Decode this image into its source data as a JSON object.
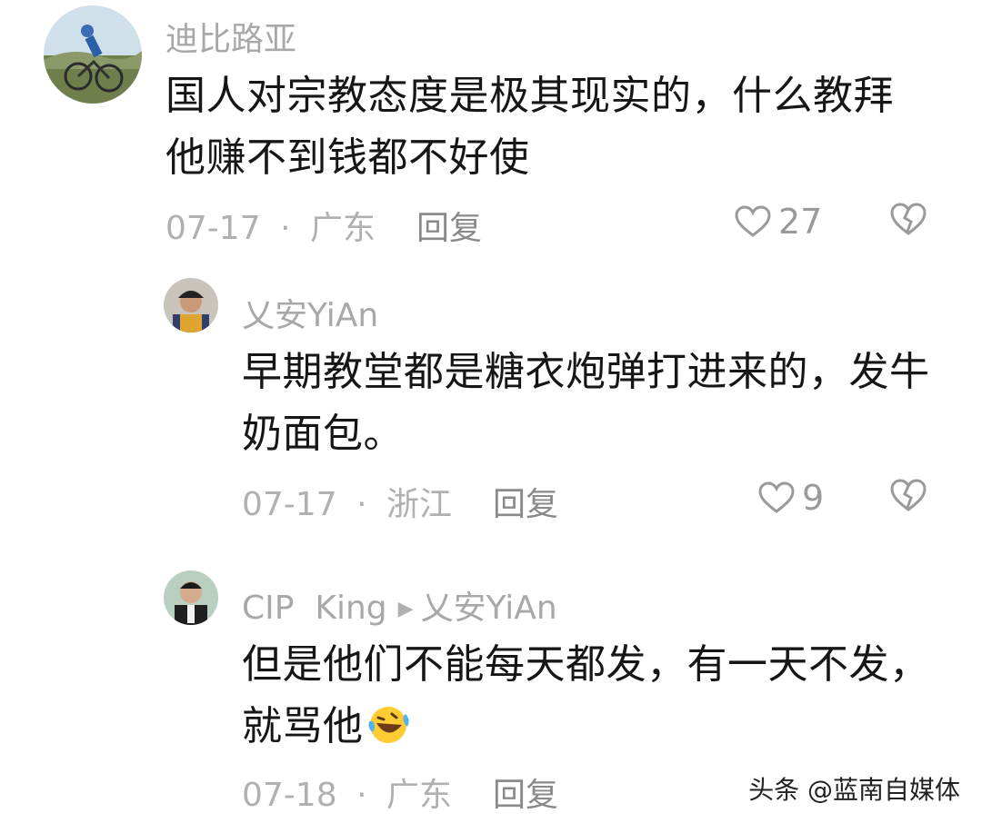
{
  "comments": [
    {
      "username": "迪比路亚",
      "text": "国人对宗教态度是极其现实的，什么教拜他赚不到钱都不好使",
      "line1": "国人对宗教态度是极其现实的，什么教拜",
      "line2": "他赚不到钱都不好使",
      "date": "07-17",
      "separator": "·",
      "location": "广东",
      "reply_label": "回复",
      "likes": "27"
    },
    {
      "username": "乂安YiAn",
      "line1": "早期教堂都是糖衣炮弹打进来的，发牛",
      "line2": "奶面包。",
      "date": "07-17",
      "separator": "·",
      "location": "浙江",
      "reply_label": "回复",
      "likes": "9"
    },
    {
      "username": "CIP  King",
      "reply_to": "乂安YiAn",
      "line1": "但是他们不能每天都发，有一天不发，",
      "line2": "就骂他",
      "emoji": "laugh-cry-emoji",
      "date": "07-18",
      "separator": "·",
      "location": "广东",
      "reply_label": "回复"
    }
  ],
  "watermark": "头条 @蓝南自媒体",
  "colors": {
    "text": "#161616",
    "muted": "#a8a8a8",
    "icon": "#9a9a9a"
  }
}
